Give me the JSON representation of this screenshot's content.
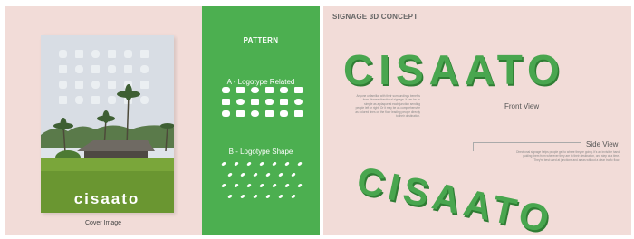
{
  "left": {
    "logo_text": "cisaato",
    "caption": "Cover Image"
  },
  "pattern": {
    "title": "PATTERN",
    "section_a": "A - Logotype Related",
    "section_b": "B - Logotype Shape"
  },
  "signage": {
    "title": "SIGNAGE 3D CONCEPT",
    "front_label": "Front View",
    "side_label": "Side View",
    "front_word": "CISAATO",
    "side_word": "CISAATO",
    "paragraph_1": "Anyone unfamiliar with their surroundings benefits from diverse directional signage. It can be as simple as a plaque at each junction sending people left or right. Or it may be as comprehensive as colored lines on the floor leading people directly to their destination.",
    "paragraph_2": "Directional signage helps people get to where they're going. It's an invisible hand guiding them from wherever they are to their destination, one step at a time. They're best used at junctions and areas without a clear traffic flow."
  },
  "colors": {
    "beige": "#f2dcd8",
    "green": "#4caf50",
    "dark_green": "#3d8b3d"
  }
}
